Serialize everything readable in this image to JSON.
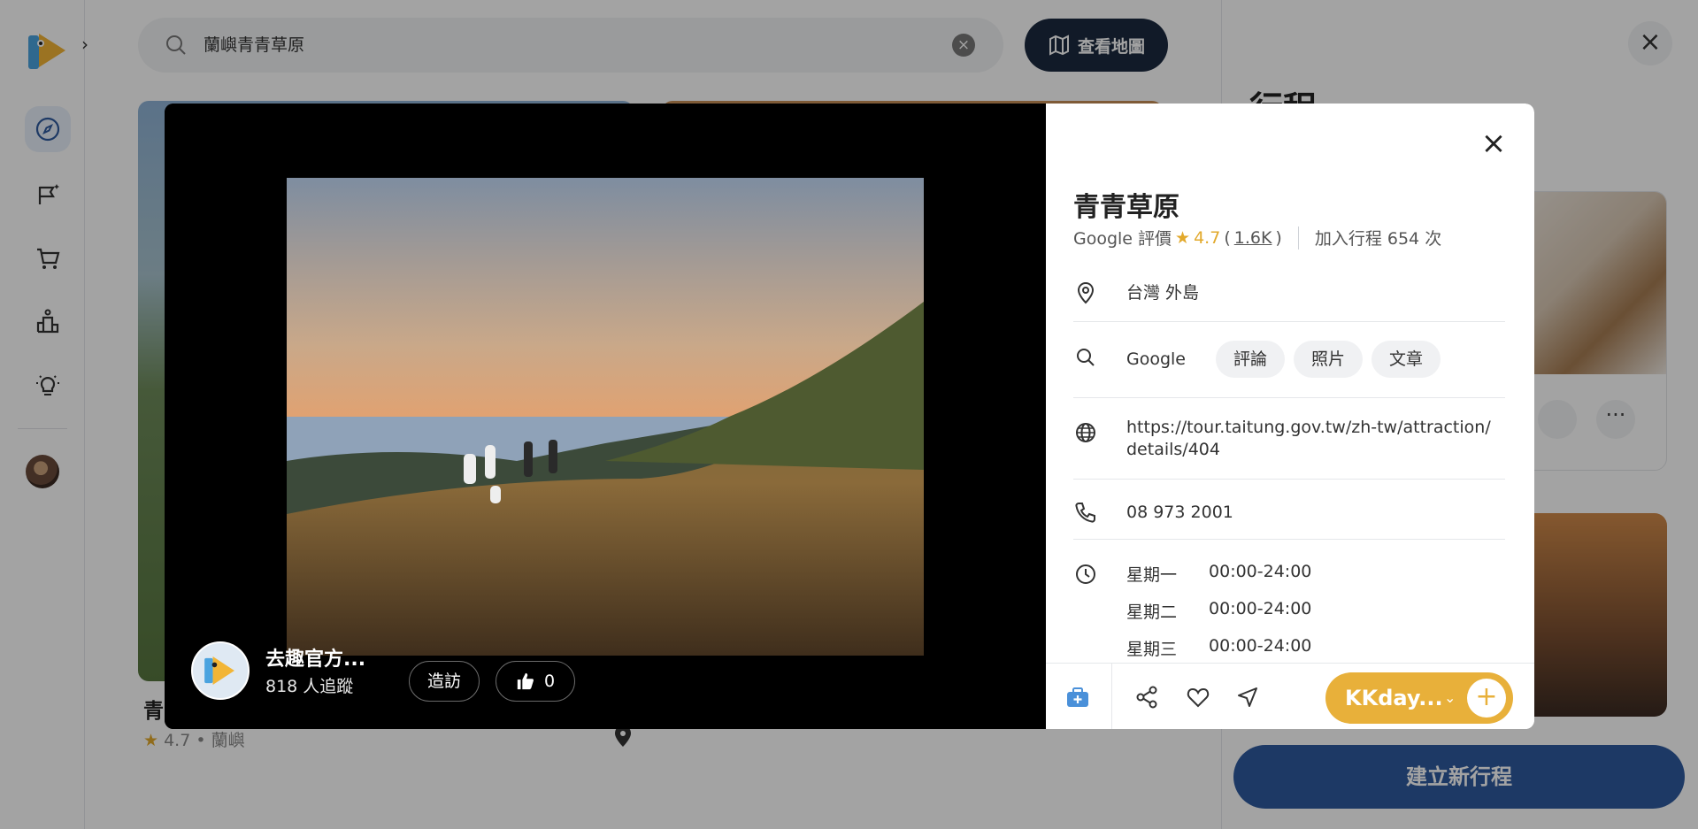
{
  "search": {
    "query": "蘭嶼青青草原",
    "map_button": "查看地圖"
  },
  "background_card": {
    "title": "青",
    "rating": "4.7",
    "location": "• 蘭嶼"
  },
  "right_panel": {
    "title": "行程",
    "create_button": "建立新行程"
  },
  "photo_viewer": {
    "author_name": "去趣官方...",
    "followers": "818 人追蹤",
    "visit_button": "造訪",
    "like_count": "0"
  },
  "poi": {
    "title": "青青草原",
    "rating_prefix": "Google 評價",
    "rating_value": "4.7",
    "rating_count": "1.6K",
    "added_count": "加入行程 654 次",
    "location": "台灣 外島",
    "search_label": "Google",
    "chips": [
      "評論",
      "照片",
      "文章"
    ],
    "website": "https://tour.taitung.gov.tw/zh-tw/attraction/details/404",
    "phone": "08 973 2001",
    "hours": [
      {
        "day": "星期一",
        "time": "00:00-24:00"
      },
      {
        "day": "星期二",
        "time": "00:00-24:00"
      },
      {
        "day": "星期三",
        "time": "00:00-24:00"
      }
    ]
  },
  "action_bar": {
    "provider_label": "KKday..."
  },
  "colors": {
    "brand_navy": "#1c2a3f",
    "accent_gold": "#e8b03a",
    "primary_blue": "#2e5a9e",
    "star": "#e2a92c"
  },
  "icons": [
    "explore-icon",
    "trip-flag-icon",
    "cart-icon",
    "ranking-icon",
    "idea-bulb-icon",
    "search-icon",
    "map-icon",
    "close-icon",
    "location-pin-icon",
    "globe-icon",
    "phone-icon",
    "clock-icon",
    "add-to-trip-icon",
    "share-icon",
    "heart-icon",
    "navigate-icon",
    "thumb-up-icon"
  ]
}
